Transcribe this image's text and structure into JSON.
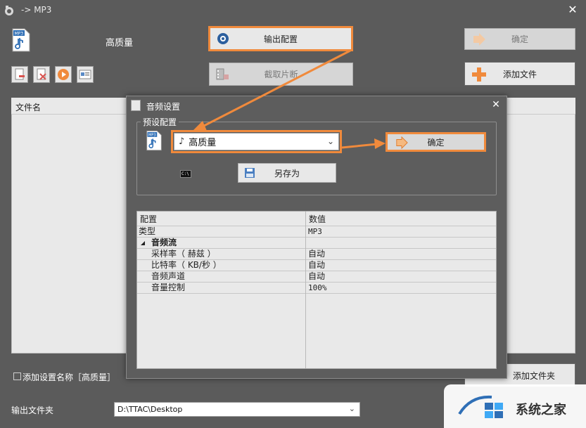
{
  "window": {
    "title": "-> MP3",
    "close_glyph": "✕"
  },
  "toolbar": {
    "preset_label": "高质量",
    "output_config_label": "输出配置",
    "clip_label": "截取片断",
    "ok_label": "确定",
    "add_file_label": "添加文件"
  },
  "file_list": {
    "header": "文件名"
  },
  "bottom": {
    "add_preset_name_label": "添加设置名称［高质量］",
    "add_folder_label": "添加文件夹",
    "output_folder_label": "输出文件夹",
    "output_folder_path": "D:\\TTAC\\Desktop"
  },
  "dialog": {
    "title": "音频设置",
    "close_glyph": "✕",
    "preset_group_label": "预设配置",
    "preset_value": "高质量",
    "ok_label": "确定",
    "save_as_label": "另存为",
    "grid": {
      "header": {
        "name": "配置",
        "value": "数值"
      },
      "rows": [
        {
          "name": "类型",
          "value": "MP3"
        },
        {
          "name": "音频流",
          "value": "",
          "group": true
        },
        {
          "name": "采样率（ 赫兹 ）",
          "value": "自动"
        },
        {
          "name": "比特率（ KB/秒 ）",
          "value": "自动"
        },
        {
          "name": "音频声道",
          "value": "自动"
        },
        {
          "name": "音量控制",
          "value": "100%"
        }
      ]
    }
  },
  "watermark": {
    "site_name": "系统之家"
  },
  "colors": {
    "accent_orange": "#f08a3c",
    "window_bg": "#5b5b5b",
    "list_bg": "#e9e9e9"
  }
}
